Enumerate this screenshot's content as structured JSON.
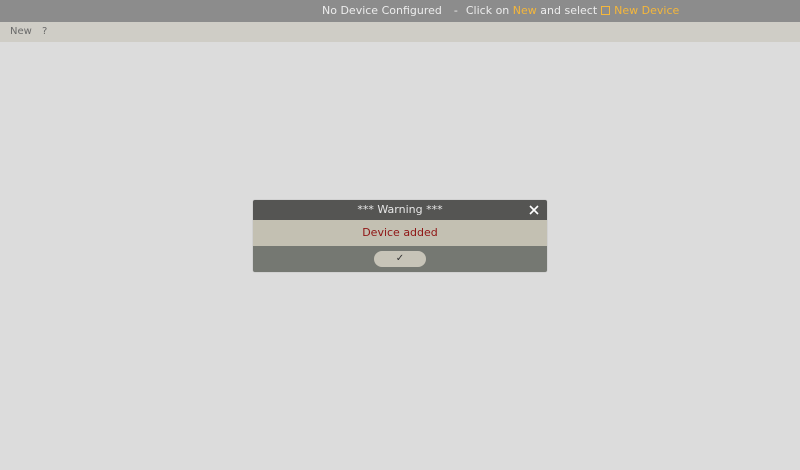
{
  "status_bar": {
    "text_1": "No Device Configured",
    "separator": "-",
    "text_2": "Click on",
    "link_new": "New",
    "text_3": "and select",
    "link_new_device": "New Device",
    "highlight_color": "#f5b73b"
  },
  "menu": {
    "new_label": "New",
    "help_label": "?"
  },
  "dialog": {
    "title": "*** Warning ***",
    "message": "Device added",
    "ok_label": "✓",
    "close_icon": "close-icon"
  }
}
